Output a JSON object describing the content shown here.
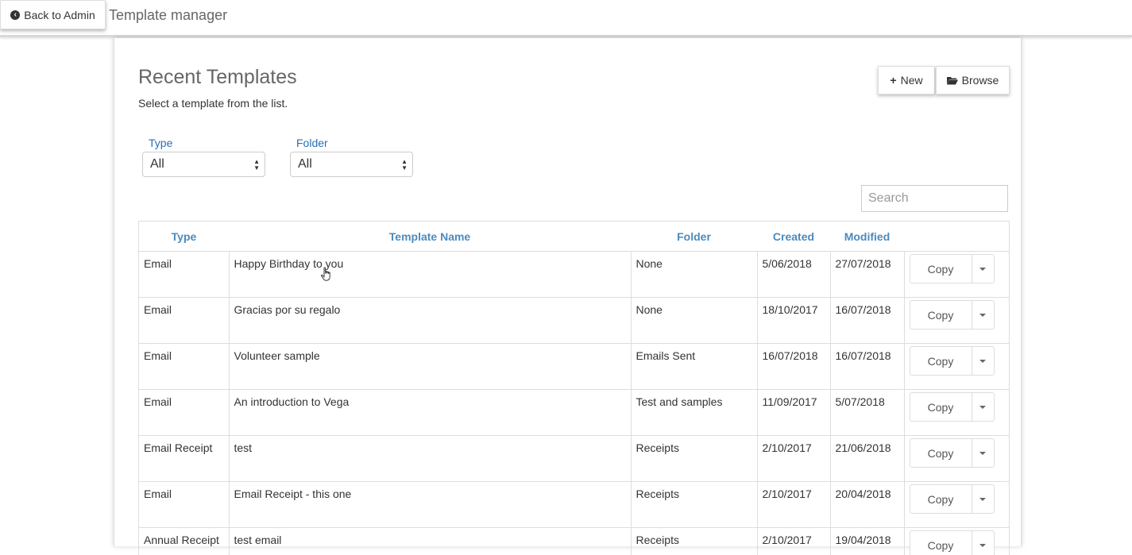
{
  "header": {
    "back_label": "Back to Admin",
    "back_icon": "arrow-circle-left-icon",
    "app_title": "Template manager"
  },
  "main": {
    "title": "Recent Templates",
    "subtitle": "Select a template from the list.",
    "new_label": "New",
    "new_icon": "plus-icon",
    "browse_label": "Browse",
    "browse_icon": "folder-open-icon"
  },
  "filters": {
    "type_label": "Type",
    "type_value": "All",
    "folder_label": "Folder",
    "folder_value": "All"
  },
  "search": {
    "placeholder": "Search"
  },
  "table": {
    "headers": [
      "Type",
      "Template Name",
      "Folder",
      "Created",
      "Modified",
      ""
    ],
    "rows": [
      {
        "type": "Email",
        "name": "Happy Birthday to you",
        "folder": "None",
        "created": "5/06/2018",
        "modified": "27/07/2018",
        "action": "Copy"
      },
      {
        "type": "Email",
        "name": "Gracias por su regalo",
        "folder": "None",
        "created": "18/10/2017",
        "modified": "16/07/2018",
        "action": "Copy"
      },
      {
        "type": "Email",
        "name": "Volunteer sample",
        "folder": "Emails Sent",
        "created": "16/07/2018",
        "modified": "16/07/2018",
        "action": "Copy"
      },
      {
        "type": "Email",
        "name": "An introduction to Vega",
        "folder": "Test and samples",
        "created": "11/09/2017",
        "modified": "5/07/2018",
        "action": "Copy"
      },
      {
        "type": "Email Receipt",
        "name": "test",
        "folder": "Receipts",
        "created": "2/10/2017",
        "modified": "21/06/2018",
        "action": "Copy"
      },
      {
        "type": "Email",
        "name": "Email Receipt - this one",
        "folder": "Receipts",
        "created": "2/10/2017",
        "modified": "20/04/2018",
        "action": "Copy"
      },
      {
        "type": "Annual Receipt",
        "name": "test email",
        "folder": "Receipts",
        "created": "2/10/2017",
        "modified": "19/04/2018",
        "action": "Copy"
      }
    ]
  },
  "colors": {
    "link_blue": "#4b8bbe",
    "label_blue": "#2a6eb5"
  }
}
